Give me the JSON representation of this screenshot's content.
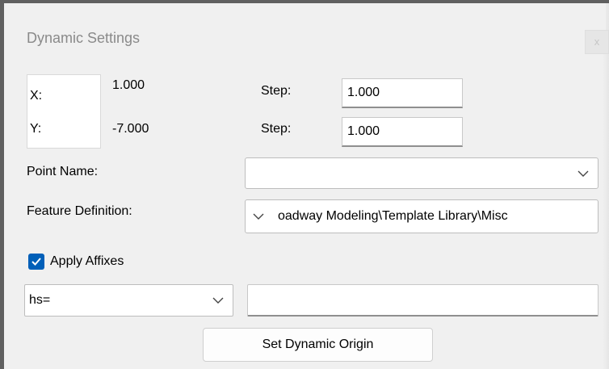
{
  "window": {
    "title": "Dynamic Settings",
    "close_glyph": "x"
  },
  "coords": {
    "x_label": "X:",
    "y_label": "Y:",
    "x_value": "1.000",
    "y_value": "-7.000"
  },
  "steps": {
    "step_label_1": "Step:",
    "step_value_1": "1.000",
    "step_label_2": "Step:",
    "step_value_2": "1.000"
  },
  "point_name": {
    "label": "Point Name:",
    "value": ""
  },
  "feature_definition": {
    "label": "Feature Definition:",
    "value": "oadway Modeling\\Template Library\\Misc"
  },
  "affixes": {
    "label": "Apply Affixes",
    "checked": true,
    "prefix_value": "hs=",
    "suffix_value": ""
  },
  "actions": {
    "set_origin_label": "Set Dynamic Origin"
  },
  "colors": {
    "accent": "#005fb8",
    "window_bg": "#f0f0f0"
  }
}
